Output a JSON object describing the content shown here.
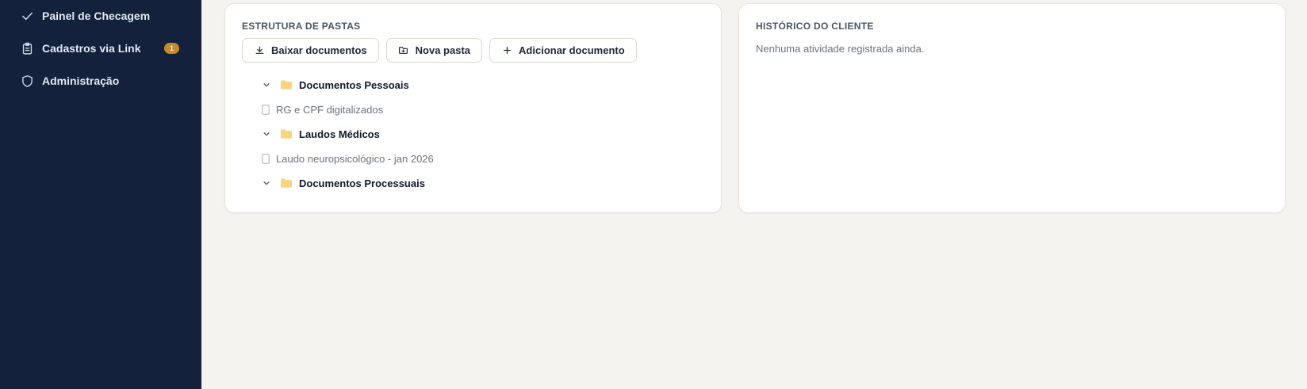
{
  "sidebar": {
    "items": [
      {
        "label": "Painel de Checagem",
        "icon": "check-icon"
      },
      {
        "label": "Cadastros via Link",
        "icon": "clipboard-icon",
        "badge": "1"
      },
      {
        "label": "Administração",
        "icon": "shield-icon"
      }
    ]
  },
  "folders_card": {
    "title": "ESTRUTURA DE PASTAS",
    "buttons": {
      "download_label": "Baixar documentos",
      "new_folder_label": "Nova pasta",
      "add_document_label": "Adicionar documento"
    },
    "tree": [
      {
        "type": "folder",
        "label": "Documentos Pessoais",
        "expanded": true
      },
      {
        "type": "file",
        "label": "RG e CPF digitalizados"
      },
      {
        "type": "folder",
        "label": "Laudos Médicos",
        "expanded": true
      },
      {
        "type": "file",
        "label": "Laudo neuropsicológico - jan 2026"
      },
      {
        "type": "folder",
        "label": "Documentos Processuais",
        "expanded": true
      }
    ]
  },
  "history_card": {
    "title": "HISTÓRICO DO CLIENTE",
    "empty_text": "Nenhuma atividade registrada ainda."
  },
  "colors": {
    "sidebar_bg": "#14213d",
    "badge": "#c8892b",
    "folder": "#f6d57e",
    "page_bg": "#f5f3ef"
  }
}
